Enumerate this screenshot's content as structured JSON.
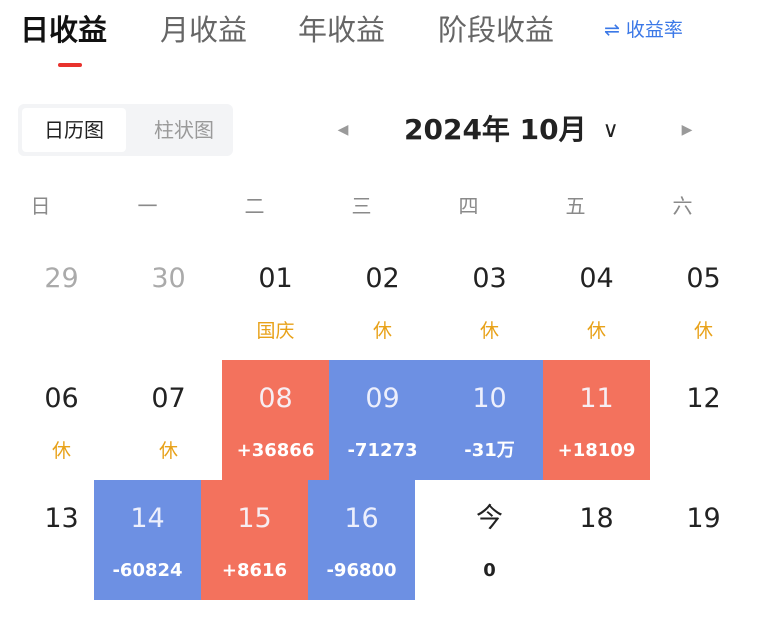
{
  "tabs": {
    "daily": "日收益",
    "monthly": "月收益",
    "yearly": "年收益",
    "period": "阶段收益",
    "rate_icon": "⇌",
    "rate_label": "收益率"
  },
  "view_toggle": {
    "calendar": "日历图",
    "bar": "柱状图"
  },
  "month_nav": {
    "prev_icon": "◀",
    "next_icon": "▶",
    "title": "2024年 10月",
    "dropdown_icon": "∨"
  },
  "weekdays": [
    "日",
    "一",
    "二",
    "三",
    "四",
    "五",
    "六"
  ],
  "calendar": {
    "d0": {
      "day": "29",
      "note": ""
    },
    "d1": {
      "day": "30",
      "note": ""
    },
    "d2": {
      "day": "01",
      "note": "国庆"
    },
    "d3": {
      "day": "02",
      "note": "休"
    },
    "d4": {
      "day": "03",
      "note": "休"
    },
    "d5": {
      "day": "04",
      "note": "休"
    },
    "d6": {
      "day": "05",
      "note": "休"
    },
    "d7": {
      "day": "06",
      "note": "休"
    },
    "d8": {
      "day": "07",
      "note": "休"
    },
    "d9": {
      "day": "08",
      "note": "+36866"
    },
    "d10": {
      "day": "09",
      "note": "-71273"
    },
    "d11": {
      "day": "10",
      "note": "-31万"
    },
    "d12": {
      "day": "11",
      "note": "+18109"
    },
    "d13": {
      "day": "12",
      "note": ""
    },
    "d14": {
      "day": "13",
      "note": ""
    },
    "d15": {
      "day": "14",
      "note": "-60824"
    },
    "d16": {
      "day": "15",
      "note": "+8616"
    },
    "d17": {
      "day": "16",
      "note": "-96800"
    },
    "d18": {
      "day": "今",
      "note": "0"
    },
    "d19": {
      "day": "18",
      "note": ""
    },
    "d20": {
      "day": "19",
      "note": ""
    }
  },
  "colors": {
    "gain": "#f3725d",
    "loss": "#6d90e3",
    "holiday": "#e8a21a",
    "accent": "#e8322d",
    "link": "#3b78e7"
  }
}
